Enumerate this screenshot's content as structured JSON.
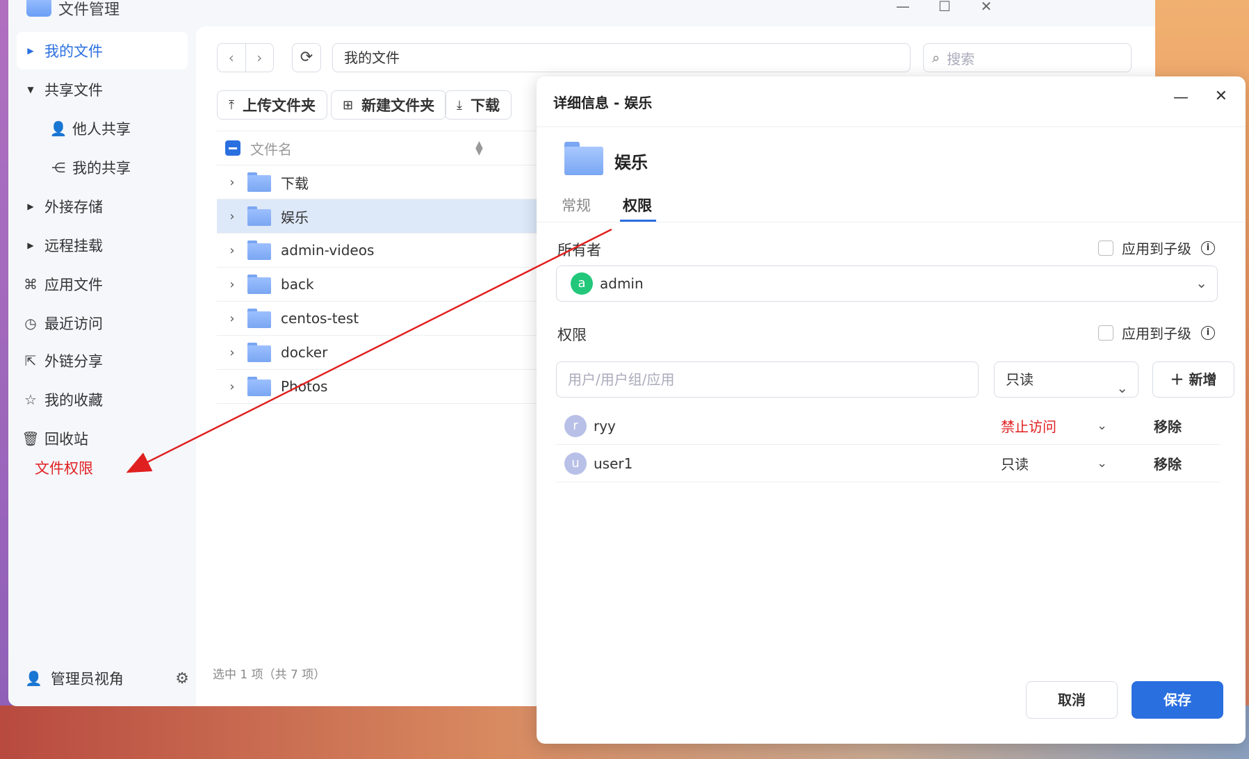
{
  "window": {
    "title": "文件管理"
  },
  "sidebar": {
    "items": [
      {
        "label": "我的文件"
      },
      {
        "label": "共享文件"
      },
      {
        "label": "他人共享"
      },
      {
        "label": "我的共享"
      },
      {
        "label": "外接存储"
      },
      {
        "label": "远程挂载"
      },
      {
        "label": "应用文件"
      },
      {
        "label": "最近访问"
      },
      {
        "label": "外链分享"
      },
      {
        "label": "我的收藏"
      },
      {
        "label": "回收站"
      }
    ],
    "annotation": "文件权限",
    "admin_view": "管理员视角"
  },
  "toolbar": {
    "path": "我的文件",
    "search_placeholder": "搜索",
    "upload_folder": "上传文件夹",
    "new_folder": "新建文件夹",
    "download": "下载"
  },
  "files": {
    "header": "文件名",
    "rows": [
      "下载",
      "娱乐",
      "admin-videos",
      "back",
      "centos-test",
      "docker",
      "Photos"
    ],
    "status": "选中 1 项（共 7 项）"
  },
  "dialog": {
    "title": "详细信息 - 娱乐",
    "folder_name": "娱乐",
    "tabs": [
      "常规",
      "权限"
    ],
    "owner_label": "所有者",
    "apply_child": "应用到子级",
    "owner": {
      "initial": "a",
      "name": "admin"
    },
    "perm_label": "权限",
    "user_placeholder": "用户/用户组/应用",
    "perm_select": "只读",
    "add_label": "新增",
    "entries": [
      {
        "initial": "r",
        "name": "ryy",
        "level": "禁止访问",
        "remove": "移除"
      },
      {
        "initial": "u",
        "name": "user1",
        "level": "只读",
        "remove": "移除"
      }
    ],
    "cancel": "取消",
    "save": "保存"
  },
  "colors": {
    "accent": "#2a6fe0",
    "deny": "#e02020",
    "owner_avatar": "#22c77a"
  }
}
